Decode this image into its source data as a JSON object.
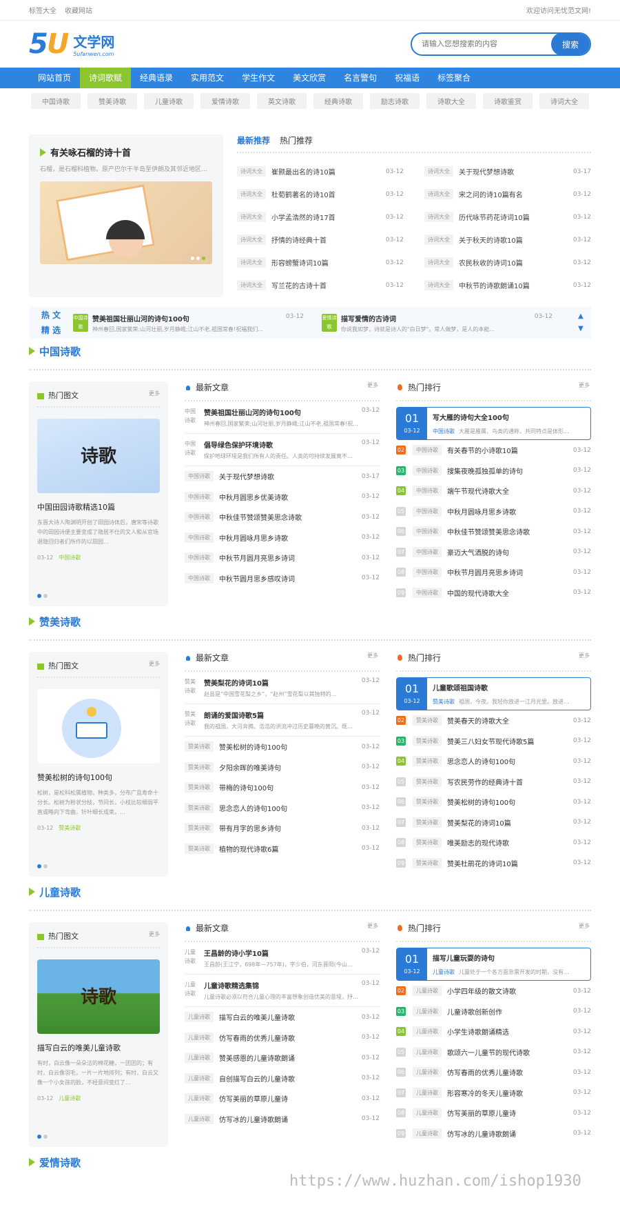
{
  "topbar": {
    "links": [
      "标签大全",
      "收藏网站"
    ],
    "welcome": "欢迎访问无忧范文网!"
  },
  "logo": {
    "num": "5",
    "u": "U",
    "name": "文学网",
    "domain": "5ufanwen.com"
  },
  "search": {
    "placeholder": "请输入您想搜索的内容",
    "button": "搜索"
  },
  "nav": [
    "网站首页",
    "诗词歌赋",
    "经典语录",
    "实用范文",
    "学生作文",
    "美文欣赏",
    "名言警句",
    "祝福语",
    "标签聚合"
  ],
  "tags": [
    "中国诗歌",
    "赞美诗歌",
    "儿童诗歌",
    "爱情诗歌",
    "英文诗歌",
    "经典诗歌",
    "励志诗歌",
    "诗歌大全",
    "诗歌鉴赏",
    "诗词大全"
  ],
  "featured": {
    "title": "有关咏石榴的诗十首",
    "desc": "石榴，是石榴科植物。原产巴尔干半岛至伊朗及其邻近地区..."
  },
  "recommend": {
    "tabs": [
      "最新推荐",
      "热门推荐"
    ],
    "items": [
      [
        "诗词大全",
        "崔颢最出名的诗10篇",
        "03-12"
      ],
      [
        "诗词大全",
        "关于现代梦想诗歌",
        "03-17"
      ],
      [
        "诗词大全",
        "杜荀鹤著名的诗10首",
        "03-12"
      ],
      [
        "诗词大全",
        "宋之问的诗10篇有名",
        "03-12"
      ],
      [
        "诗词大全",
        "小学孟浩然的诗17首",
        "03-12"
      ],
      [
        "诗词大全",
        "历代咏节药花诗词10篇",
        "03-12"
      ],
      [
        "诗词大全",
        "抒情的诗经典十首",
        "03-12"
      ],
      [
        "诗词大全",
        "关于秋天的诗歌10篇",
        "03-12"
      ],
      [
        "诗词大全",
        "形容螃蟹诗词10篇",
        "03-12"
      ],
      [
        "诗词大全",
        "农民秋收的诗词10篇",
        "03-12"
      ],
      [
        "诗词大全",
        "写兰花的古诗十首",
        "03-12"
      ],
      [
        "诗词大全",
        "中秋节的诗歌朗诵10篇",
        "03-12"
      ]
    ]
  },
  "hot": {
    "label1": "热 文",
    "label2": "精 选",
    "items": [
      {
        "badge": "中国诗歌",
        "title": "赞美祖国壮丽山河的诗句100句",
        "date": "03-12",
        "desc": "神州春回,国家繁荣;山河壮丽,岁月静峨;江山不老,祖国常春!祝福我们..."
      },
      {
        "badge": "爱情诗歌",
        "title": "描写爱情的古诗词",
        "date": "03-12",
        "desc": "你说我如梦，诗就是诗人的\"白日梦\"。常人做梦，是人的本能..."
      }
    ]
  },
  "sections": [
    {
      "title": "中国诗歌",
      "card": {
        "head": "热门图文",
        "more": "更多",
        "title": "中国田园诗歌精选10篇",
        "desc": "东晋大诗人陶渊明开创了田园诗体后，唐宋等诗歌中的田园诗便主要变成了隐居不仕的文人和从官场退隐回归者们所作的以田园...",
        "date": "03-12",
        "tag": "中国诗歌",
        "img": "诗歌"
      },
      "latest": {
        "head": "最新文章",
        "more": "更多",
        "top": [
          {
            "tag": "中国诗歌",
            "title": "赞美祖国壮丽山河的诗句100句",
            "date": "03-12",
            "desc": "神州春回,国家繁荣;山河壮丽,岁月静峨;江山不老,祖国常春!祝..."
          },
          {
            "tag": "中国诗歌",
            "title": "倡导绿色保护环境诗歌",
            "date": "03-12",
            "desc": "保护地球环境是我们所有人的责任。人类的可持续发展离不..."
          }
        ],
        "list": [
          [
            "中国诗歌",
            "关于现代梦想诗歌",
            "03-17"
          ],
          [
            "中国诗歌",
            "中秋月圆思乡优美诗歌",
            "03-12"
          ],
          [
            "中国诗歌",
            "中秋佳节赞颂赞美思念诗歌",
            "03-12"
          ],
          [
            "中国诗歌",
            "中秋月圆咏月思乡诗歌",
            "03-12"
          ],
          [
            "中国诗歌",
            "中秋节月圆月亮思乡诗词",
            "03-12"
          ],
          [
            "中国诗歌",
            "中秋节圆月思乡感叹诗词",
            "03-12"
          ]
        ]
      },
      "rank": {
        "head": "热门排行",
        "more": "更多",
        "first": {
          "num": "01",
          "date": "03-12",
          "title": "写大雁的诗句大全100句",
          "tag": "中国诗歌",
          "desc": "大雁是雁属、鸟类的通称，共同特点是体形..."
        },
        "list": [
          [
            "02",
            "中国诗歌",
            "有关春节的小诗歌10篇",
            "03-12"
          ],
          [
            "03",
            "中国诗歌",
            "搜集夜晚孤独孤单的诗句",
            "03-12"
          ],
          [
            "04",
            "中国诗歌",
            "端午节现代诗歌大全",
            "03-12"
          ],
          [
            "05",
            "中国诗歌",
            "中秋月圆咏月思乡诗歌",
            "03-12"
          ],
          [
            "06",
            "中国诗歌",
            "中秋佳节赞颂赞美思念诗歌",
            "03-12"
          ],
          [
            "07",
            "中国诗歌",
            "豪迈大气洒脱的诗句",
            "03-12"
          ],
          [
            "08",
            "中国诗歌",
            "中秋节月圆月亮思乡诗词",
            "03-12"
          ],
          [
            "09",
            "中国诗歌",
            "中国的现代诗歌大全",
            "03-12"
          ]
        ]
      }
    },
    {
      "title": "赞美诗歌",
      "card": {
        "head": "热门图文",
        "more": "更多",
        "title": "赞美松树的诗句100句",
        "desc": "松树，是松科松属植物，种类多，分布广且寿命十分长。松树为粉状分枝，节间长，小枝比较细弱平直或略向下弯曲，针叶细长成束。...",
        "date": "03-12",
        "tag": "赞美诗歌",
        "img": "book"
      },
      "latest": {
        "head": "最新文章",
        "more": "更多",
        "top": [
          {
            "tag": "赞美诗歌",
            "title": "赞美梨花的诗词10篇",
            "date": "03-12",
            "desc": "赵县是“中国雪花梨之乡”，“赵州”雪花梨以其独特的..."
          },
          {
            "tag": "赞美诗歌",
            "title": "朗诵的爱国诗歌5篇",
            "date": "03-12",
            "desc": "我的祖国，大河奔腾。浩浩的洪流冲过历史暮晚的黄沉。既..."
          }
        ],
        "list": [
          [
            "赞美诗歌",
            "赞美松树的诗句100句",
            "03-12"
          ],
          [
            "赞美诗歌",
            "夕阳余晖的唯美诗句",
            "03-12"
          ],
          [
            "赞美诗歌",
            "带梅的诗句100句",
            "03-12"
          ],
          [
            "赞美诗歌",
            "思念恋人的诗句100句",
            "03-12"
          ],
          [
            "赞美诗歌",
            "带有月字的思乡诗句",
            "03-12"
          ],
          [
            "赞美诗歌",
            "植物的现代诗歌6篇",
            "03-12"
          ]
        ]
      },
      "rank": {
        "head": "热门排行",
        "more": "更多",
        "first": {
          "num": "01",
          "date": "03-12",
          "title": "儿童歌颂祖国诗歌",
          "tag": "赞美诗歌",
          "desc": "祖国，今夜。我轻你放进一江月光里。放进..."
        },
        "list": [
          [
            "02",
            "赞美诗歌",
            "赞美春天的诗歌大全",
            "03-12"
          ],
          [
            "03",
            "赞美诗歌",
            "赞美三八妇女节现代诗歌5篇",
            "03-12"
          ],
          [
            "04",
            "赞美诗歌",
            "思念恋人的诗句100句",
            "03-12"
          ],
          [
            "05",
            "赞美诗歌",
            "写农民劳作的经典诗十首",
            "03-12"
          ],
          [
            "06",
            "赞美诗歌",
            "赞美松树的诗句100句",
            "03-12"
          ],
          [
            "07",
            "赞美诗歌",
            "赞美梨花的诗词10篇",
            "03-12"
          ],
          [
            "08",
            "赞美诗歌",
            "唯美励志的现代诗歌",
            "03-12"
          ],
          [
            "09",
            "赞美诗歌",
            "赞美杜鹃花的诗词10篇",
            "03-12"
          ]
        ]
      }
    },
    {
      "title": "儿童诗歌",
      "card": {
        "head": "热门图文",
        "more": "更多",
        "title": "描写白云的唯美儿童诗歌",
        "desc": "有时，白云像一朵朵洁的棉花糖，一团团的；有时，白云像羽毛，一片一片地排列；有时，白云又像一个小女孩的脸，不经意间变红了...",
        "date": "03-12",
        "tag": "儿童诗歌",
        "img": "诗歌"
      },
      "latest": {
        "head": "最新文章",
        "more": "更多",
        "top": [
          {
            "tag": "儿童诗歌",
            "title": "王昌龄的诗小学10篇",
            "date": "03-12",
            "desc": "王昌龄(王江宁，698年—757年)，字少伯，河东晋阳(今山..."
          },
          {
            "tag": "儿童诗歌",
            "title": "儿童诗歌精选集锦",
            "date": "03-12",
            "desc": "儿童诗歌必须以符合儿童心理的丰富想象创造优美的意境，抒..."
          }
        ],
        "list": [
          [
            "儿童诗歌",
            "描写白云的唯美儿童诗歌",
            "03-12"
          ],
          [
            "儿童诗歌",
            "仿写春雨的优秀儿童诗歌",
            "03-12"
          ],
          [
            "儿童诗歌",
            "赞美感恩的儿童诗歌朗诵",
            "03-12"
          ],
          [
            "儿童诗歌",
            "自创描写白云的儿童诗歌",
            "03-12"
          ],
          [
            "儿童诗歌",
            "仿写美丽的草原儿童诗",
            "03-12"
          ],
          [
            "儿童诗歌",
            "仿写冰的儿童诗歌朗诵",
            "03-12"
          ]
        ]
      },
      "rank": {
        "head": "热门排行",
        "more": "更多",
        "first": {
          "num": "01",
          "date": "03-12",
          "title": "描写儿童玩耍的诗句",
          "tag": "儿童诗歌",
          "desc": "儿童处于一个各方面急需开发的时期，没有..."
        },
        "list": [
          [
            "02",
            "儿童诗歌",
            "小学四年级的散文诗歌",
            "03-12"
          ],
          [
            "03",
            "儿童诗歌",
            "儿童诗歌创新创作",
            "03-12"
          ],
          [
            "04",
            "儿童诗歌",
            "小学生诗歌朗诵精选",
            "03-12"
          ],
          [
            "05",
            "儿童诗歌",
            "歌颂六一儿童节的现代诗歌",
            "03-12"
          ],
          [
            "06",
            "儿童诗歌",
            "仿写春雨的优秀儿童诗歌",
            "03-12"
          ],
          [
            "07",
            "儿童诗歌",
            "形容寒冷的冬天儿童诗歌",
            "03-12"
          ],
          [
            "08",
            "儿童诗歌",
            "仿写美丽的草原儿童诗",
            "03-12"
          ],
          [
            "09",
            "儿童诗歌",
            "仿写冰的儿童诗歌朗诵",
            "03-12"
          ]
        ]
      }
    }
  ],
  "next_section": "爱情诗歌",
  "watermark": "https://www.huzhan.com/ishop1930",
  "colors": {
    "primary": "#2e84de",
    "accent": "#8bc52f",
    "fire": "#f26b1d"
  }
}
